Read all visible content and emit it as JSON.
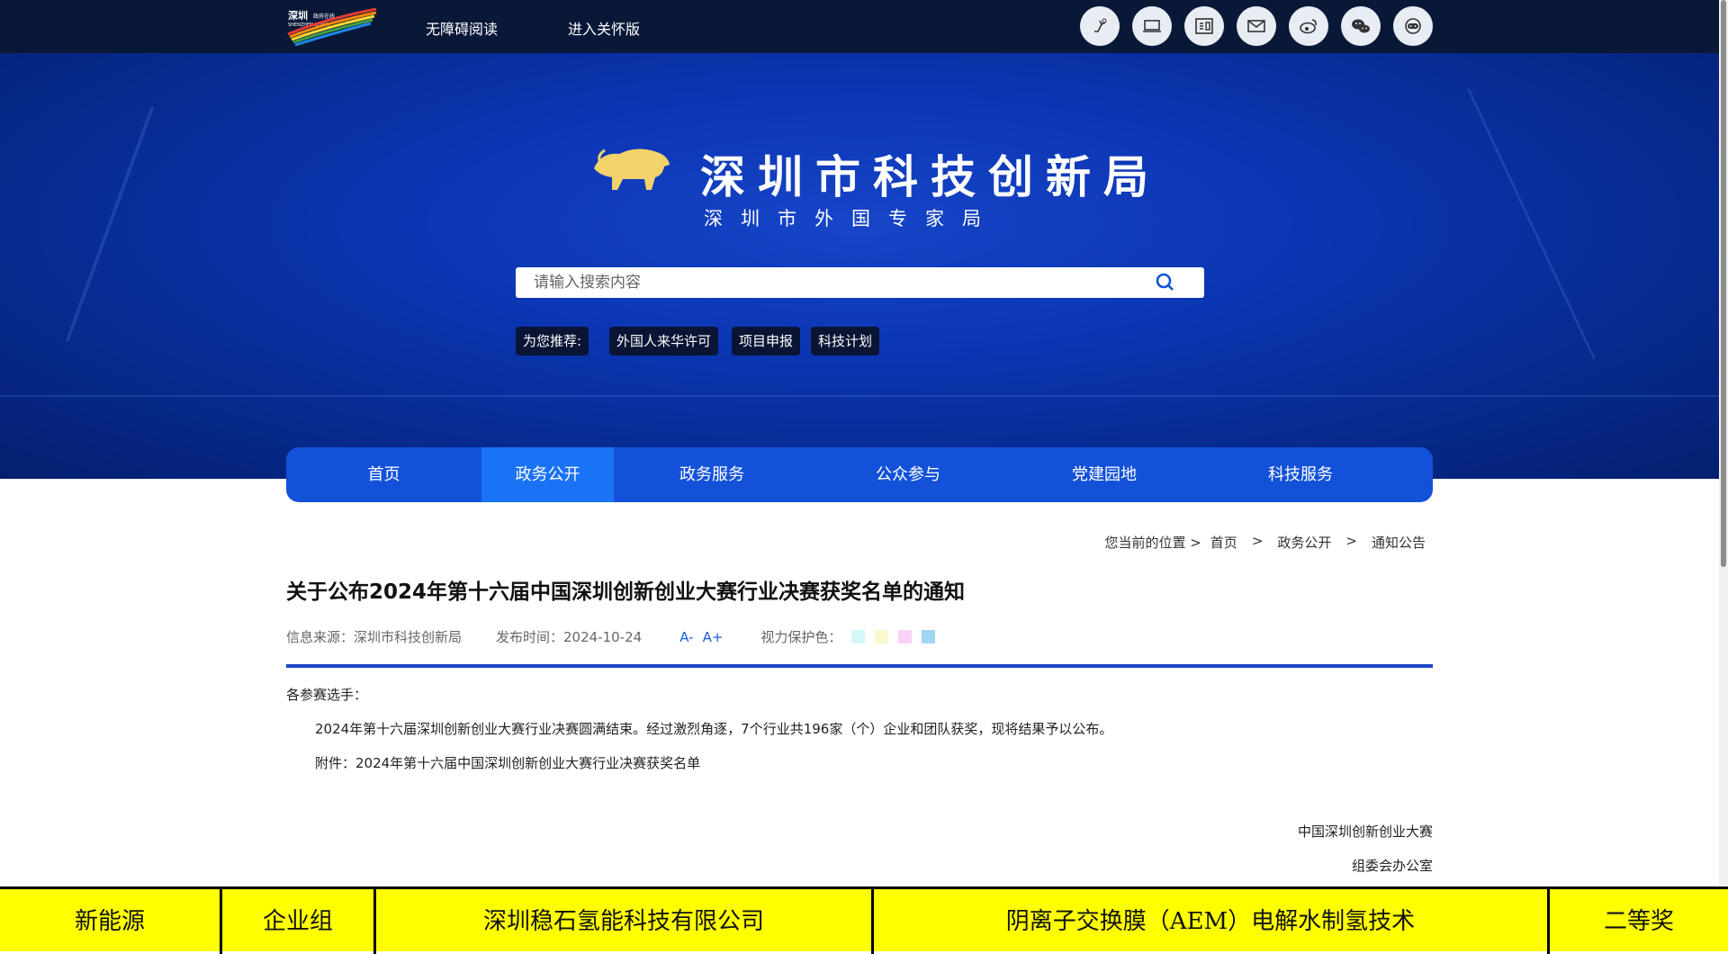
{
  "topbar": {
    "logo_icon": "shenzhen-logo",
    "accessibility_link": "无障碍阅读",
    "care_mode_link": "进入关怀版",
    "icons": [
      "robot-service-icon",
      "laptop-icon",
      "id-card-icon",
      "mail-icon",
      "weibo-icon",
      "wechat-icon",
      "chatbot-icon"
    ]
  },
  "banner": {
    "org_name": "深圳市科技创新局",
    "org_subname": "深圳市外国专家局",
    "search_placeholder": "请输入搜索内容",
    "recommend_label": "为您推荐:",
    "recommend_tags": [
      "外国人来华许可",
      "项目申报",
      "科技计划"
    ]
  },
  "nav": {
    "items": [
      "首页",
      "政务公开",
      "政务服务",
      "公众参与",
      "党建园地",
      "科技服务"
    ],
    "active_index": 1
  },
  "breadcrumb": {
    "prefix": "您当前的位置 >",
    "items": [
      "首页",
      "政务公开",
      "通知公告"
    ],
    "separator": ">"
  },
  "article": {
    "title": "关于公布2024年第十六届中国深圳创新创业大赛行业决赛获奖名单的通知",
    "source": "信息来源：深圳市科技创新局",
    "date": "发布时间：2024-10-24",
    "font_smaller": "A-",
    "font_larger": "A+",
    "eye_protect_label": "视力保护色：",
    "eye_colors": [
      "#d6f7f7",
      "#fbf8cf",
      "#f8d2f3",
      "#9fd6f2"
    ],
    "greeting": "各参赛选手：",
    "body": "2024年第十六届深圳创新创业大赛行业决赛圆满结束。经过激烈角逐，7个行业共196家（个）企业和团队获奖，现将结果予以公布。",
    "attachment": "附件：2024年第十六届中国深圳创新创业大赛行业决赛获奖名单",
    "signature_line1": "中国深圳创新创业大赛",
    "signature_line2": "组委会办公室"
  },
  "award_row": {
    "cells": [
      "新能源",
      "企业组",
      "深圳稳石氢能科技有限公司",
      "阴离子交换膜（AEM）电解水制氢技术",
      "二等奖"
    ],
    "background": "#ffff00"
  },
  "colors": {
    "topbar": "#0a1838",
    "nav": "#1352d8",
    "nav_active": "#1a73f5",
    "rule": "#1a45c8"
  }
}
